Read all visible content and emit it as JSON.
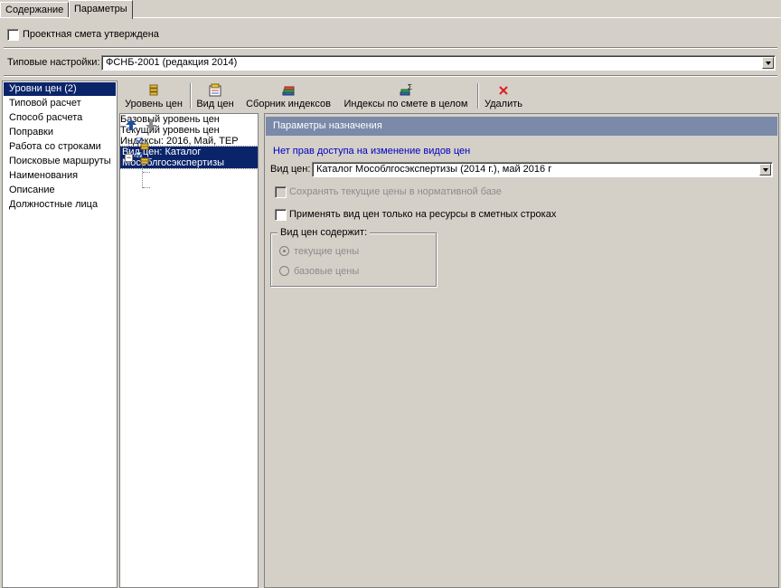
{
  "tabs": [
    {
      "label": "Содержание",
      "active": false
    },
    {
      "label": "Параметры",
      "active": true
    }
  ],
  "approved_checkbox": {
    "label": "Проектная смета утверждена",
    "checked": false
  },
  "typical_settings": {
    "label": "Типовые настройки:",
    "value": "ФСНБ-2001 (редакция 2014)"
  },
  "left_list": [
    {
      "label": "Уровни цен (2)",
      "selected": true
    },
    {
      "label": "Типовой расчет"
    },
    {
      "label": "Способ расчета"
    },
    {
      "label": "Поправки"
    },
    {
      "label": "Работа со строками"
    },
    {
      "label": "Поисковые маршруты"
    },
    {
      "label": "Наименования"
    },
    {
      "label": "Описание"
    },
    {
      "label": "Должностные лица"
    }
  ],
  "toolbar": {
    "price_level": "Уровень цен",
    "price_type": "Вид цен",
    "index_collection": "Сборник индексов",
    "indexes_total": "Индексы по смете в целом",
    "delete": "Удалить"
  },
  "tree": {
    "base": "Базовый уровень цен",
    "current": "Текущий уровень цен",
    "indexes": "Индексы: 2016, Май, ТЕР",
    "price_type": "Вид цен: Каталог Мособлгосэкспертизы"
  },
  "panel": {
    "title": "Параметры назначения",
    "no_access": "Нет прав доступа на изменение видов цен",
    "price_type_label": "Вид цен:",
    "price_type_value": "Каталог Мособлгосэкспертизы (2014 г.), май 2016 г",
    "save_prices": "Сохранять текущие цены в нормативной базе",
    "apply_only": "Применять вид цен только на ресурсы в сметных строках",
    "group_title": "Вид цен содержит:",
    "radio_current": "текущие цены",
    "radio_base": "базовые цены"
  },
  "colors": {
    "selection": "#0a246a",
    "link_blue": "#0000c0",
    "panel_header": "#7a8aa8",
    "delete_red": "#e02020"
  }
}
